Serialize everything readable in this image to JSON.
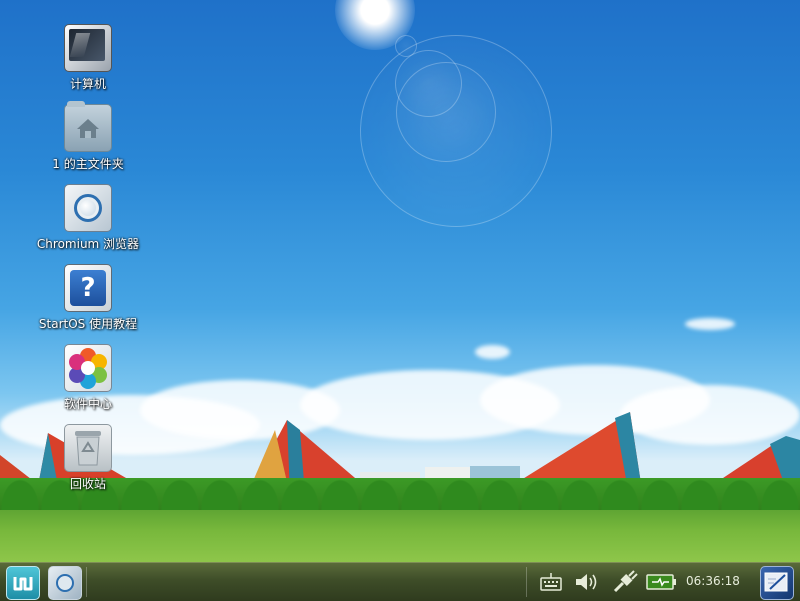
{
  "desktop": {
    "icons": [
      {
        "label": "计算机",
        "icon": "computer-icon"
      },
      {
        "label": "1 的主文件夹",
        "icon": "home-folder-icon"
      },
      {
        "label": "Chromium 浏览器",
        "icon": "chromium-icon"
      },
      {
        "label": "StartOS 使用教程",
        "icon": "help-icon"
      },
      {
        "label": "软件中心",
        "icon": "software-center-icon"
      },
      {
        "label": "回收站",
        "icon": "trash-icon"
      }
    ]
  },
  "taskbar": {
    "start_icon": "startos-logo-icon",
    "launcher_icon": "chromium-icon",
    "tray": [
      "keyboard-icon",
      "volume-icon",
      "network-icon",
      "battery-icon"
    ],
    "clock": "06:36:18",
    "show_desktop_icon": "show-desktop-icon"
  },
  "colors": {
    "sky_top": "#1f71c9",
    "taskbar": "#3e4d28"
  }
}
